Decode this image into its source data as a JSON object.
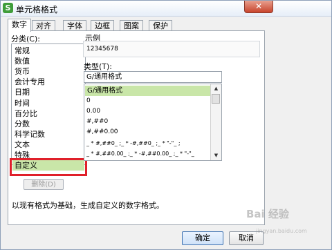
{
  "window": {
    "title": "单元格格式",
    "app_icon": "S",
    "close_glyph": "✕"
  },
  "tabs": [
    {
      "label": "数字",
      "active": true
    },
    {
      "label": "对齐",
      "active": false
    },
    {
      "label": "字体",
      "active": false
    },
    {
      "label": "边框",
      "active": false
    },
    {
      "label": "图案",
      "active": false
    },
    {
      "label": "保护",
      "active": false
    }
  ],
  "category": {
    "label": "分类(C):",
    "items": [
      "常规",
      "数值",
      "货币",
      "会计专用",
      "日期",
      "时间",
      "百分比",
      "分数",
      "科学记数",
      "文本",
      "特殊",
      "自定义"
    ],
    "selected_index": 11,
    "delete_button": "删除(D)"
  },
  "sample": {
    "label": "示例",
    "value": "12345678"
  },
  "type": {
    "label": "类型(T):",
    "input_value": "G/通用格式",
    "items": [
      "G/通用格式",
      "0",
      "0.00",
      "#,##0",
      "#,##0.00",
      "_ * #,##0_ ;_ * -#,##0_ ;_ * \"-\"_ ;",
      "_ * #,##0.00_ ;_ * -#,##0.00_ ;_ * \"-\"_"
    ],
    "selected_index": 0
  },
  "description": "以现有格式为基础，生成自定义的数字格式。",
  "buttons": {
    "ok": "确定",
    "cancel": "取消"
  },
  "watermark": {
    "main": "Bai 经验",
    "sub": "jingyan.baidu.com"
  },
  "colors": {
    "selection": "#c9e6a8",
    "highlight_border": "#e0202a",
    "app_icon": "#3f9d3a"
  }
}
